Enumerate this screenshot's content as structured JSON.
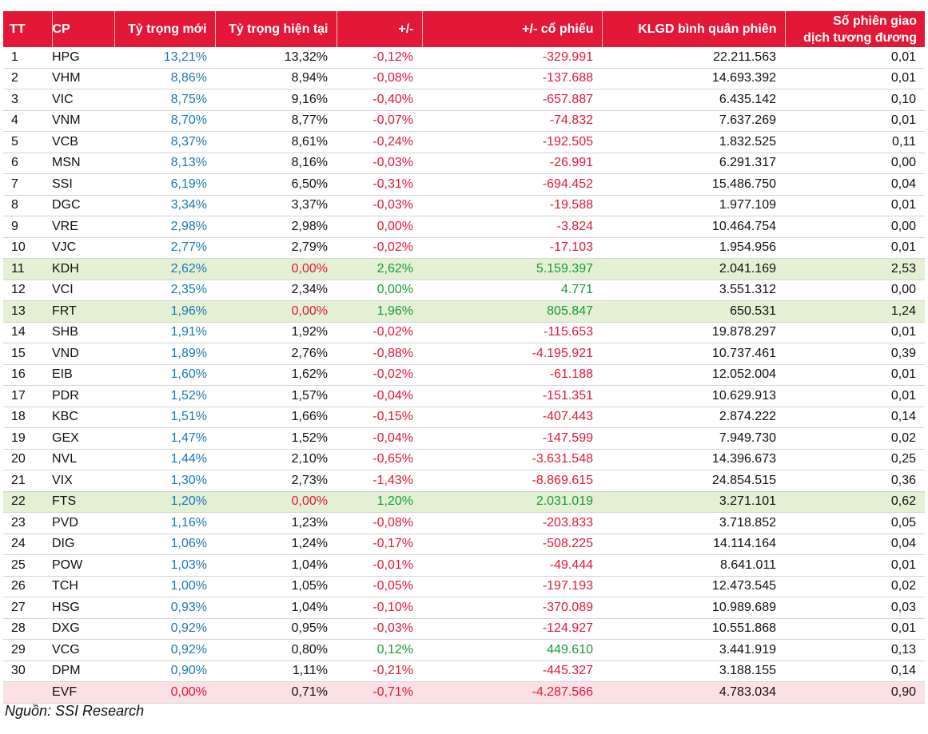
{
  "headers": {
    "tt": "TT",
    "cp": "CP",
    "new_weight": "Tỷ trọng mới",
    "current_weight": "Tỷ trọng hiện tại",
    "diff": "+/-",
    "diff_shares": "+/- cổ phiếu",
    "avg_volume": "KLGD bình quân phiên",
    "sessions_line1": "Số phiên giao",
    "sessions_line2": "dịch tương đương"
  },
  "rows": [
    {
      "tt": "1",
      "cp": "HPG",
      "new": "13,21%",
      "cur": "13,32%",
      "diff": "-0,12%",
      "shares": "-329.991",
      "vol": "22.211.563",
      "sess": "0,01",
      "hl": "",
      "dc": "red",
      "cc": ""
    },
    {
      "tt": "2",
      "cp": "VHM",
      "new": "8,86%",
      "cur": "8,94%",
      "diff": "-0,08%",
      "shares": "-137.688",
      "vol": "14.693.392",
      "sess": "0,01",
      "hl": "",
      "dc": "red",
      "cc": ""
    },
    {
      "tt": "3",
      "cp": "VIC",
      "new": "8,75%",
      "cur": "9,16%",
      "diff": "-0,40%",
      "shares": "-657.887",
      "vol": "6.435.142",
      "sess": "0,10",
      "hl": "",
      "dc": "red",
      "cc": ""
    },
    {
      "tt": "4",
      "cp": "VNM",
      "new": "8,70%",
      "cur": "8,77%",
      "diff": "-0,07%",
      "shares": "-74.832",
      "vol": "7.637.269",
      "sess": "0,01",
      "hl": "",
      "dc": "red",
      "cc": ""
    },
    {
      "tt": "5",
      "cp": "VCB",
      "new": "8,37%",
      "cur": "8,61%",
      "diff": "-0,24%",
      "shares": "-192.505",
      "vol": "1.832.525",
      "sess": "0,11",
      "hl": "",
      "dc": "red",
      "cc": ""
    },
    {
      "tt": "6",
      "cp": "MSN",
      "new": "8,13%",
      "cur": "8,16%",
      "diff": "-0,03%",
      "shares": "-26.991",
      "vol": "6.291.317",
      "sess": "0,00",
      "hl": "",
      "dc": "red",
      "cc": ""
    },
    {
      "tt": "7",
      "cp": "SSI",
      "new": "6,19%",
      "cur": "6,50%",
      "diff": "-0,31%",
      "shares": "-694.452",
      "vol": "15.486.750",
      "sess": "0,04",
      "hl": "",
      "dc": "red",
      "cc": ""
    },
    {
      "tt": "8",
      "cp": "DGC",
      "new": "3,34%",
      "cur": "3,37%",
      "diff": "-0,03%",
      "shares": "-19.588",
      "vol": "1.977.109",
      "sess": "0,01",
      "hl": "",
      "dc": "red",
      "cc": ""
    },
    {
      "tt": "9",
      "cp": "VRE",
      "new": "2,98%",
      "cur": "2,98%",
      "diff": "0,00%",
      "shares": "-3.824",
      "vol": "10.464.754",
      "sess": "0,00",
      "hl": "",
      "dc": "red",
      "cc": ""
    },
    {
      "tt": "10",
      "cp": "VJC",
      "new": "2,77%",
      "cur": "2,79%",
      "diff": "-0,02%",
      "shares": "-17.103",
      "vol": "1.954.956",
      "sess": "0,01",
      "hl": "",
      "dc": "red",
      "cc": ""
    },
    {
      "tt": "11",
      "cp": "KDH",
      "new": "2,62%",
      "cur": "0,00%",
      "diff": "2,62%",
      "shares": "5.159.397",
      "vol": "2.041.169",
      "sess": "2,53",
      "hl": "hl-green",
      "dc": "green",
      "cc": "red"
    },
    {
      "tt": "12",
      "cp": "VCI",
      "new": "2,35%",
      "cur": "2,34%",
      "diff": "0,00%",
      "shares": "4.771",
      "vol": "3.551.312",
      "sess": "0,00",
      "hl": "",
      "dc": "green",
      "cc": ""
    },
    {
      "tt": "13",
      "cp": "FRT",
      "new": "1,96%",
      "cur": "0,00%",
      "diff": "1,96%",
      "shares": "805.847",
      "vol": "650.531",
      "sess": "1,24",
      "hl": "hl-green",
      "dc": "green",
      "cc": "red"
    },
    {
      "tt": "14",
      "cp": "SHB",
      "new": "1,91%",
      "cur": "1,92%",
      "diff": "-0,02%",
      "shares": "-115.653",
      "vol": "19.878.297",
      "sess": "0,01",
      "hl": "",
      "dc": "red",
      "cc": ""
    },
    {
      "tt": "15",
      "cp": "VND",
      "new": "1,89%",
      "cur": "2,76%",
      "diff": "-0,88%",
      "shares": "-4.195.921",
      "vol": "10.737.461",
      "sess": "0,39",
      "hl": "",
      "dc": "red",
      "cc": ""
    },
    {
      "tt": "16",
      "cp": "EIB",
      "new": "1,60%",
      "cur": "1,62%",
      "diff": "-0,02%",
      "shares": "-61.188",
      "vol": "12.052.004",
      "sess": "0,01",
      "hl": "",
      "dc": "red",
      "cc": ""
    },
    {
      "tt": "17",
      "cp": "PDR",
      "new": "1,52%",
      "cur": "1,57%",
      "diff": "-0,04%",
      "shares": "-151.351",
      "vol": "10.629.913",
      "sess": "0,01",
      "hl": "",
      "dc": "red",
      "cc": ""
    },
    {
      "tt": "18",
      "cp": "KBC",
      "new": "1,51%",
      "cur": "1,66%",
      "diff": "-0,15%",
      "shares": "-407.443",
      "vol": "2.874.222",
      "sess": "0,14",
      "hl": "",
      "dc": "red",
      "cc": ""
    },
    {
      "tt": "19",
      "cp": "GEX",
      "new": "1,47%",
      "cur": "1,52%",
      "diff": "-0,04%",
      "shares": "-147.599",
      "vol": "7.949.730",
      "sess": "0,02",
      "hl": "",
      "dc": "red",
      "cc": ""
    },
    {
      "tt": "20",
      "cp": "NVL",
      "new": "1,44%",
      "cur": "2,10%",
      "diff": "-0,65%",
      "shares": "-3.631.548",
      "vol": "14.396.673",
      "sess": "0,25",
      "hl": "",
      "dc": "red",
      "cc": ""
    },
    {
      "tt": "21",
      "cp": "VIX",
      "new": "1,30%",
      "cur": "2,73%",
      "diff": "-1,43%",
      "shares": "-8.869.615",
      "vol": "24.854.515",
      "sess": "0,36",
      "hl": "",
      "dc": "red",
      "cc": ""
    },
    {
      "tt": "22",
      "cp": "FTS",
      "new": "1,20%",
      "cur": "0,00%",
      "diff": "1,20%",
      "shares": "2.031.019",
      "vol": "3.271.101",
      "sess": "0,62",
      "hl": "hl-green",
      "dc": "green",
      "cc": "red"
    },
    {
      "tt": "23",
      "cp": "PVD",
      "new": "1,16%",
      "cur": "1,23%",
      "diff": "-0,08%",
      "shares": "-203.833",
      "vol": "3.718.852",
      "sess": "0,05",
      "hl": "",
      "dc": "red",
      "cc": ""
    },
    {
      "tt": "24",
      "cp": "DIG",
      "new": "1,06%",
      "cur": "1,24%",
      "diff": "-0,17%",
      "shares": "-508.225",
      "vol": "14.114.164",
      "sess": "0,04",
      "hl": "",
      "dc": "red",
      "cc": ""
    },
    {
      "tt": "25",
      "cp": "POW",
      "new": "1,03%",
      "cur": "1,04%",
      "diff": "-0,01%",
      "shares": "-49.444",
      "vol": "8.641.011",
      "sess": "0,01",
      "hl": "",
      "dc": "red",
      "cc": ""
    },
    {
      "tt": "26",
      "cp": "TCH",
      "new": "1,00%",
      "cur": "1,05%",
      "diff": "-0,05%",
      "shares": "-197.193",
      "vol": "12.473.545",
      "sess": "0,02",
      "hl": "",
      "dc": "red",
      "cc": ""
    },
    {
      "tt": "27",
      "cp": "HSG",
      "new": "0,93%",
      "cur": "1,04%",
      "diff": "-0,10%",
      "shares": "-370.089",
      "vol": "10.989.689",
      "sess": "0,03",
      "hl": "",
      "dc": "red",
      "cc": ""
    },
    {
      "tt": "28",
      "cp": "DXG",
      "new": "0,92%",
      "cur": "0,95%",
      "diff": "-0,03%",
      "shares": "-124.927",
      "vol": "10.551.868",
      "sess": "0,01",
      "hl": "",
      "dc": "red",
      "cc": ""
    },
    {
      "tt": "29",
      "cp": "VCG",
      "new": "0,92%",
      "cur": "0,80%",
      "diff": "0,12%",
      "shares": "449.610",
      "vol": "3.441.919",
      "sess": "0,13",
      "hl": "",
      "dc": "green",
      "cc": ""
    },
    {
      "tt": "30",
      "cp": "DPM",
      "new": "0,90%",
      "cur": "1,11%",
      "diff": "-0,21%",
      "shares": "-445.327",
      "vol": "3.188.155",
      "sess": "0,14",
      "hl": "",
      "dc": "red",
      "cc": ""
    },
    {
      "tt": "",
      "cp": "EVF",
      "new": "0,00%",
      "cur": "0,71%",
      "diff": "-0,71%",
      "shares": "-4.287.566",
      "vol": "4.783.034",
      "sess": "0,90",
      "hl": "hl-pink",
      "dc": "red",
      "cc": "",
      "nc": "red"
    }
  ],
  "source": "Nguồn: SSI Research",
  "colors": {
    "header_bg": "#e31837",
    "new_weight_text": "#1f77b4",
    "negative_text": "#e31837",
    "positive_text": "#1a9a3a",
    "added_row_bg": "#e3f0d4",
    "removed_row_bg": "#fbe0e4"
  }
}
